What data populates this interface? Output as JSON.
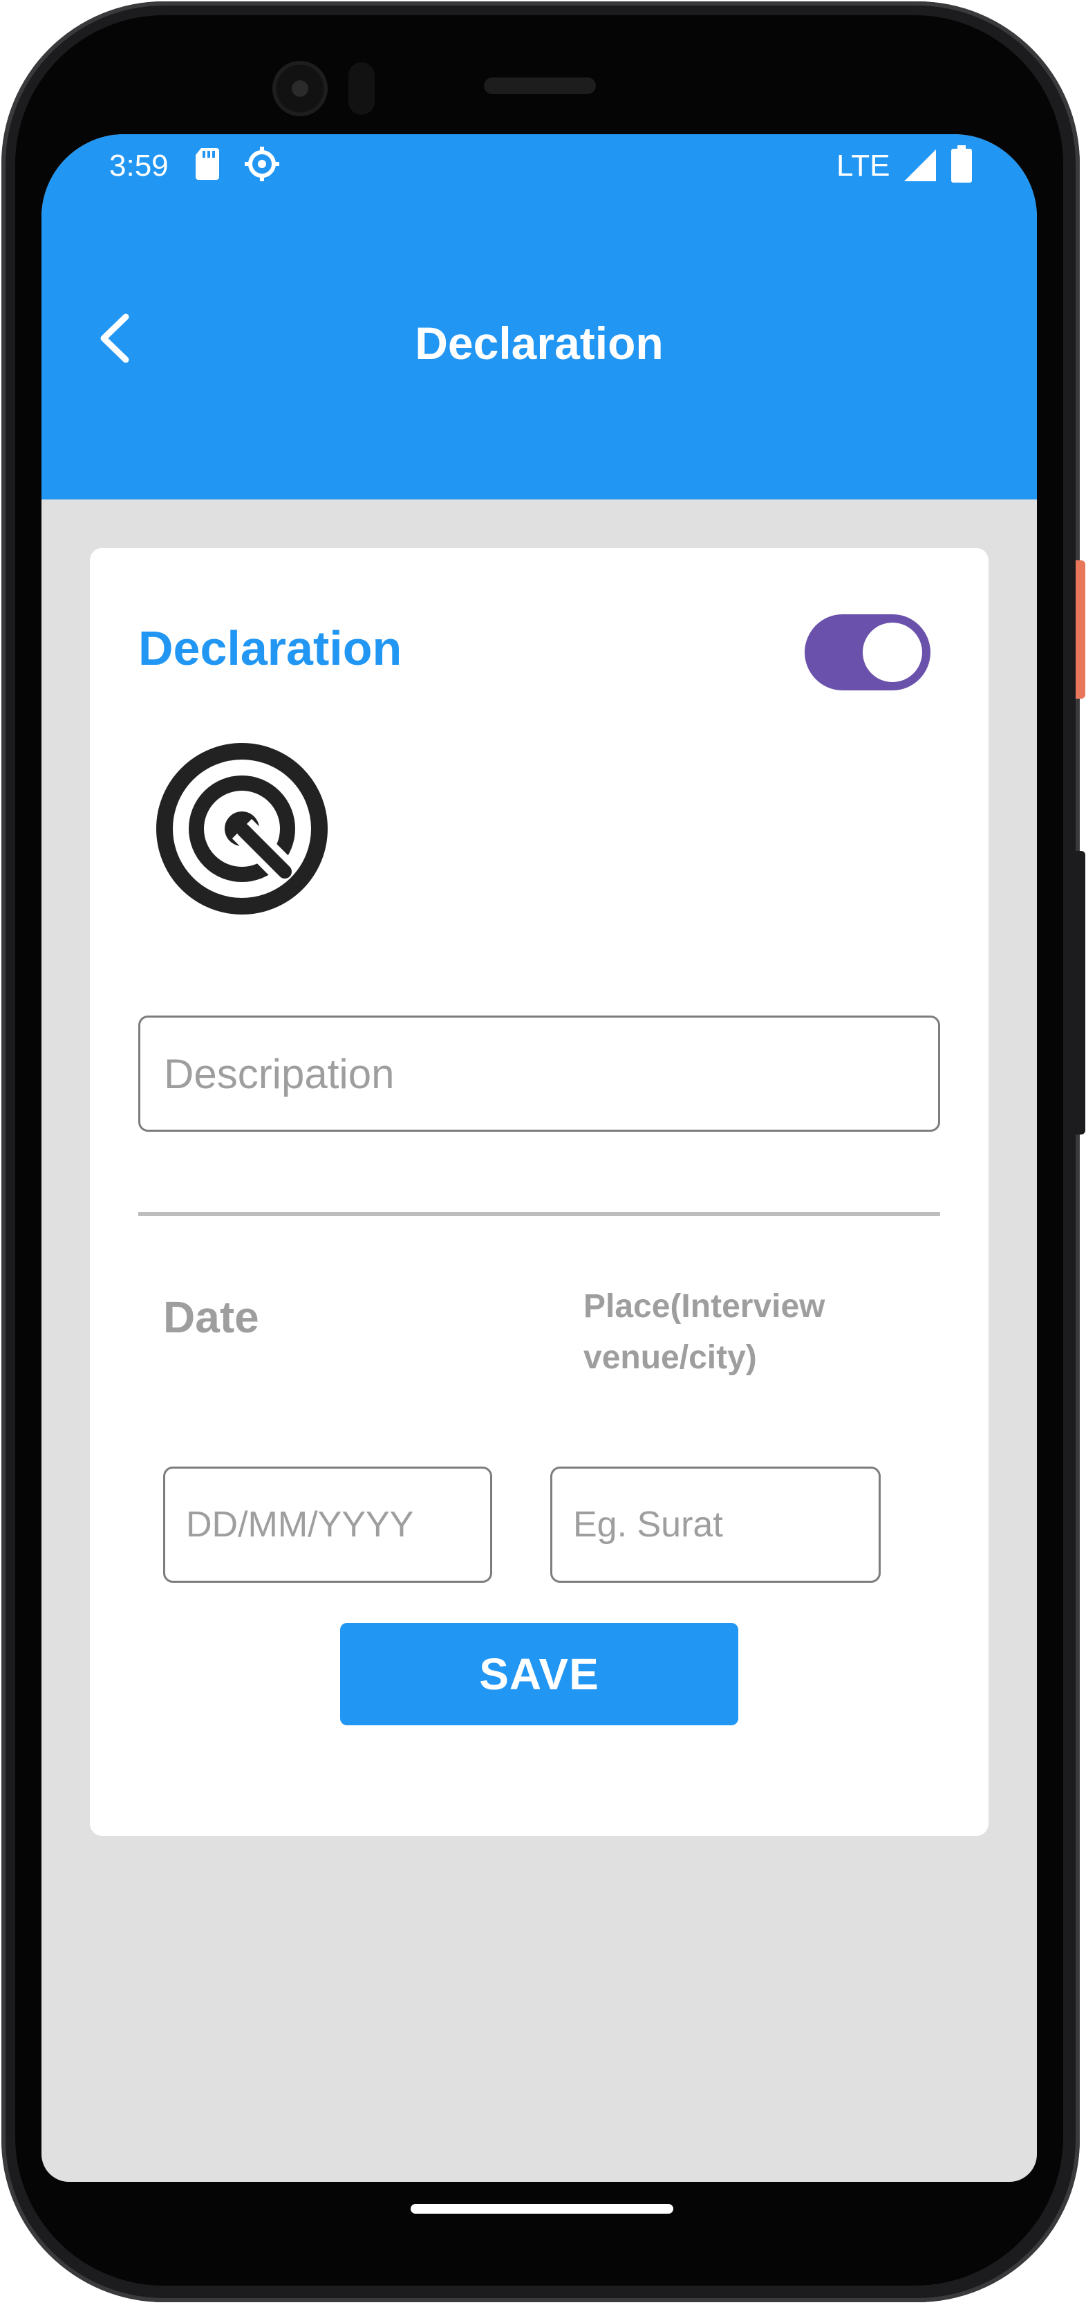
{
  "status_bar": {
    "time": "3:59",
    "network": "LTE",
    "icons": [
      "sd-card-icon",
      "gear-icon",
      "signal-icon",
      "battery-icon"
    ]
  },
  "app_bar": {
    "title": "Declaration",
    "back_icon": "chevron-left-icon"
  },
  "card": {
    "title": "Declaration",
    "toggle_on": true,
    "logo_icon": "target-search-icon",
    "description": {
      "value": "",
      "placeholder": "Descripation"
    },
    "date_label": "Date",
    "place_label": "Place(Interview venue/city)",
    "date_input": {
      "value": "",
      "placeholder": "DD/MM/YYYY"
    },
    "place_input": {
      "value": "",
      "placeholder": "Eg. Surat"
    },
    "save_label": "SAVE"
  },
  "colors": {
    "primary": "#2196f3",
    "toggle": "#6a51ab",
    "background": "#e0e0e0",
    "hint": "#9e9e9e"
  }
}
